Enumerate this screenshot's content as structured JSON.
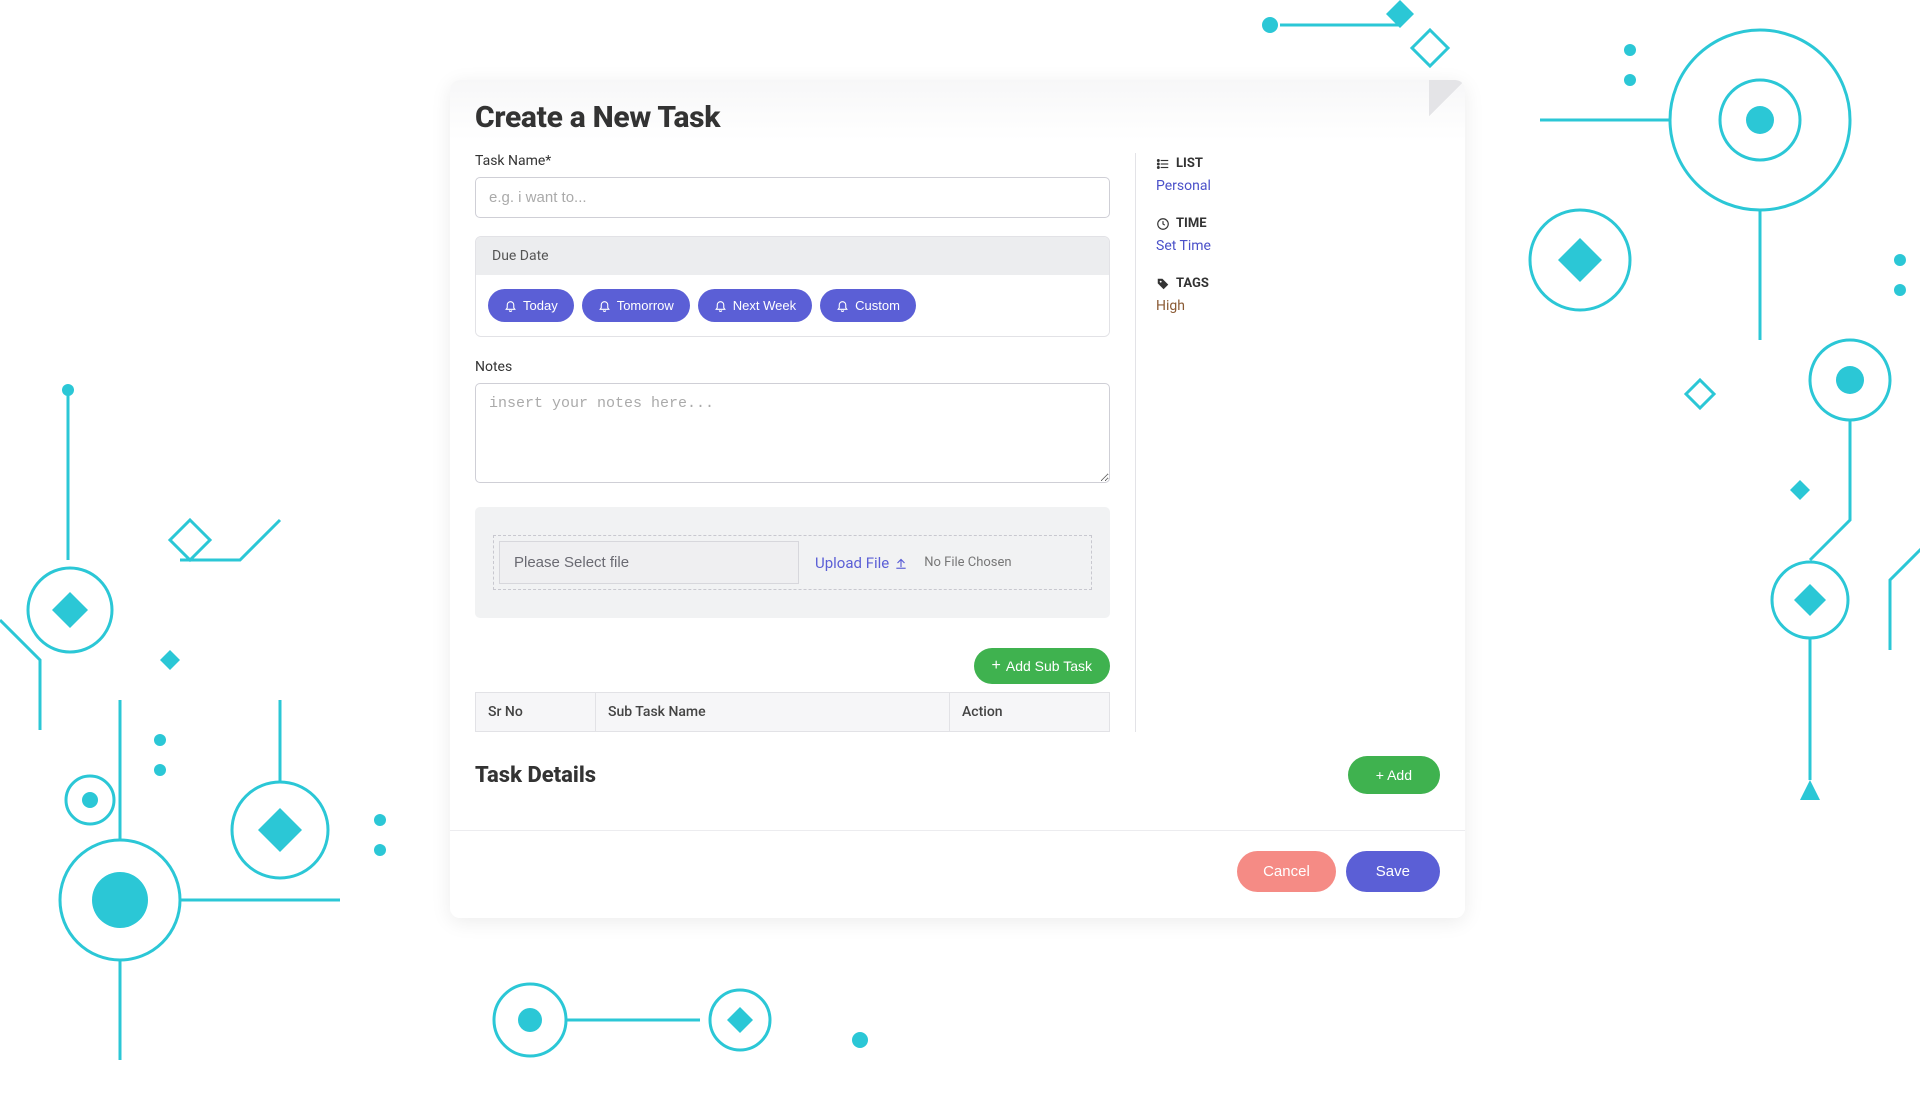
{
  "modal": {
    "title": "Create a New Task",
    "task_name": {
      "label": "Task Name*",
      "placeholder": "e.g. i want to..."
    },
    "due_date": {
      "header": "Due Date",
      "options": [
        "Today",
        "Tomorrow",
        "Next Week",
        "Custom"
      ]
    },
    "notes": {
      "label": "Notes",
      "placeholder": "insert your notes here..."
    },
    "upload": {
      "select_label": "Please Select file",
      "upload_link": "Upload File",
      "no_file": "No File Chosen"
    },
    "subtask": {
      "add_button": "Add Sub Task",
      "columns": [
        "Sr No",
        "Sub Task Name",
        "Action"
      ]
    },
    "sidebar": {
      "list": {
        "label": "LIST",
        "value": "Personal"
      },
      "time": {
        "label": "TIME",
        "value": "Set Time"
      },
      "tags": {
        "label": "TAGS",
        "value": "High"
      }
    },
    "task_details": {
      "title": "Task Details",
      "add_button": "+ Add"
    },
    "footer": {
      "cancel": "Cancel",
      "save": "Save"
    }
  }
}
